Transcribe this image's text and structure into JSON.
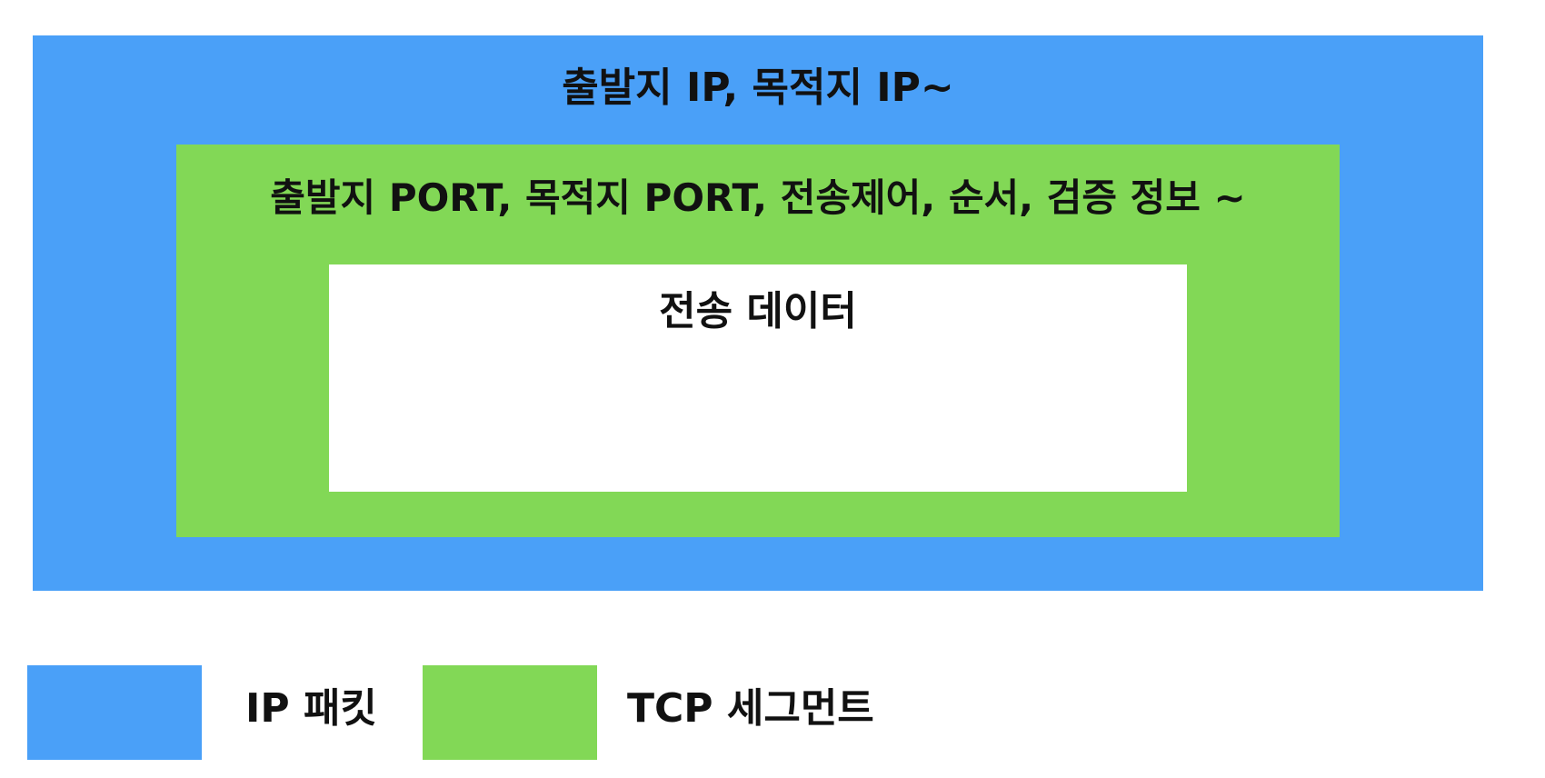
{
  "diagram": {
    "ip_packet_header": "출발지 IP, 목적지 IP~",
    "tcp_segment_header": "출발지 PORT, 목적지 PORT, 전송제어, 순서, 검증 정보 ~",
    "payload_label": "전송 데이터"
  },
  "legend": {
    "items": [
      {
        "label": "IP 패킷",
        "color": "#4aa0f8"
      },
      {
        "label": "TCP 세그먼트",
        "color": "#82d856"
      }
    ]
  }
}
